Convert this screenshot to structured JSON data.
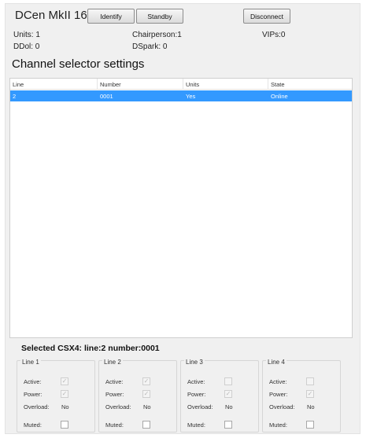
{
  "header": {
    "device_title": "DCen MkII 16",
    "identify_label": "Identify",
    "standby_label": "Standby",
    "disconnect_label": "Disconnect"
  },
  "stats": {
    "units": "Units: 1",
    "chairperson": "Chairperson:1",
    "vips": "VIPs:0",
    "ddol": "DDol: 0",
    "dspark": "DSpark: 0"
  },
  "section_title": "Channel selector settings",
  "table": {
    "columns": [
      "Line",
      "Number",
      "Units",
      "State"
    ],
    "rows": [
      {
        "line": "2",
        "number": "0001",
        "units": "Yes",
        "state": "Online",
        "selected": true
      }
    ]
  },
  "selected_csx4": "Selected CSX4:  line:2 number:0001",
  "lines": [
    {
      "title": "Line 1",
      "active_label": "Active:",
      "power_label": "Power:",
      "overload_label": "Overload:",
      "overload_value": "No",
      "muted_label": "Muted:",
      "active": true,
      "power": true,
      "muted": false
    },
    {
      "title": "Line 2",
      "active_label": "Active:",
      "power_label": "Power:",
      "overload_label": "Overload:",
      "overload_value": "No",
      "muted_label": "Muted:",
      "active": true,
      "power": true,
      "muted": false
    },
    {
      "title": "Line 3",
      "active_label": "Active:",
      "power_label": "Power:",
      "overload_label": "Overload:",
      "overload_value": "No",
      "muted_label": "Muted:",
      "active": false,
      "power": true,
      "muted": false
    },
    {
      "title": "Line 4",
      "active_label": "Active:",
      "power_label": "Power:",
      "overload_label": "Overload:",
      "overload_value": "No",
      "muted_label": "Muted:",
      "active": false,
      "power": true,
      "muted": false
    }
  ],
  "colors": {
    "selection": "#3399ff",
    "panel_background": "#f0f0f0"
  }
}
